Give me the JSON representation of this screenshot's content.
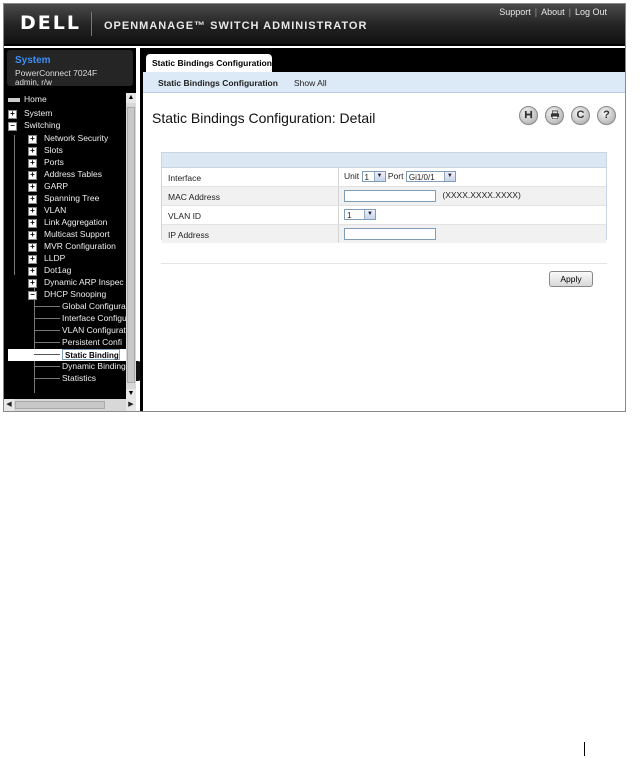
{
  "header": {
    "logo": "DELL",
    "app_title": "OPENMANAGE™ SWITCH ADMINISTRATOR",
    "links": [
      "Support",
      "About",
      "Log Out"
    ]
  },
  "system": {
    "title": "System",
    "model": "PowerConnect 7024F",
    "user": "admin, r/w"
  },
  "tree": [
    {
      "label": "Home"
    },
    {
      "label": "System"
    },
    {
      "label": "Switching"
    },
    {
      "label": "Network Security"
    },
    {
      "label": "Slots"
    },
    {
      "label": "Ports"
    },
    {
      "label": "Address Tables"
    },
    {
      "label": "GARP"
    },
    {
      "label": "Spanning Tree"
    },
    {
      "label": "VLAN"
    },
    {
      "label": "Link Aggregation"
    },
    {
      "label": "Multicast Support"
    },
    {
      "label": "MVR Configuration"
    },
    {
      "label": "LLDP"
    },
    {
      "label": "Dot1ag"
    },
    {
      "label": "Dynamic ARP Inspec"
    },
    {
      "label": "DHCP Snooping"
    },
    {
      "label": "Global Configura"
    },
    {
      "label": "Interface Configu"
    },
    {
      "label": "VLAN Configurati"
    },
    {
      "label": "Persistent Confi"
    },
    {
      "label": "Static Binding"
    },
    {
      "label": "Dynamic Binding"
    },
    {
      "label": "Statistics"
    }
  ],
  "tab": {
    "label": "Static Bindings Configuration"
  },
  "subnav": {
    "active": "Static Bindings Configuration",
    "other": "Show All"
  },
  "page_title": "Static Bindings Configuration: Detail",
  "toolbar_icons": [
    "save-icon",
    "print-icon",
    "refresh-icon",
    "help-icon"
  ],
  "form": {
    "interface": {
      "label": "Interface",
      "unit_label": "Unit",
      "unit_value": "1",
      "port_label": "Port",
      "port_value": "Gi1/0/1"
    },
    "mac": {
      "label": "MAC Address",
      "hint": "(XXXX.XXXX.XXXX)",
      "value": ""
    },
    "vlan": {
      "label": "VLAN ID",
      "value": "1"
    },
    "ip": {
      "label": "IP Address",
      "value": ""
    }
  },
  "apply_label": "Apply"
}
